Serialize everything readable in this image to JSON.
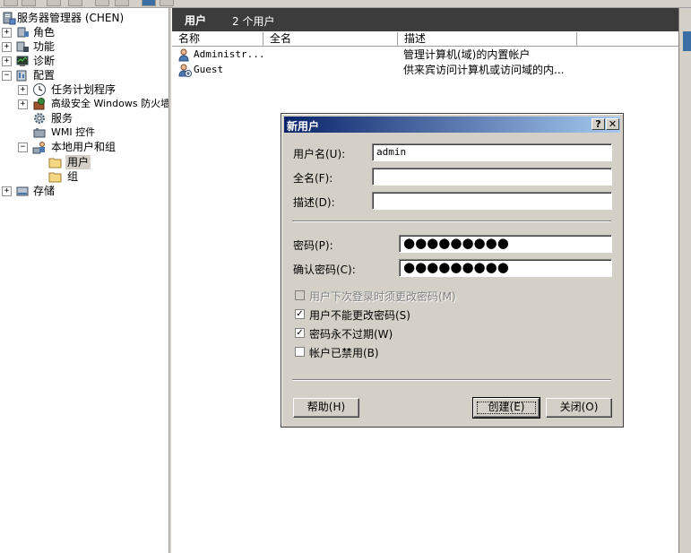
{
  "tree": {
    "root": "服务器管理器 (CHEN)",
    "roles": "角色",
    "features": "功能",
    "diagnostics": "诊断",
    "configuration": "配置",
    "task_scheduler": "任务计划程序",
    "firewall": "高级安全 Windows 防火墙",
    "services": "服务",
    "wmi": "WMI 控件",
    "local_users": "本地用户和组",
    "users": "用户",
    "groups": "组",
    "storage": "存储"
  },
  "list": {
    "title": "用户",
    "count": "2 个用户",
    "columns": [
      "名称",
      "全名",
      "描述"
    ],
    "rows": [
      {
        "name": "Administr...",
        "full_name": "",
        "description": "管理计算机(域)的内置帐户"
      },
      {
        "name": "Guest",
        "full_name": "",
        "description": "供来宾访问计算机或访问域的内..."
      }
    ]
  },
  "dialog": {
    "title": "新用户",
    "help_btn": "?",
    "close_btn": "✕",
    "username_label": "用户名(U):",
    "username_value": "admin",
    "fullname_label": "全名(F):",
    "fullname_value": "",
    "desc_label": "描述(D):",
    "desc_value": "",
    "password_label": "密码(P):",
    "password_value": "●●●●●●●●●",
    "confirm_label": "确认密码(C):",
    "confirm_value": "●●●●●●●●●",
    "checkboxes": [
      {
        "label": "用户下次登录时须更改密码(M)",
        "checked": false,
        "disabled": true
      },
      {
        "label": "用户不能更改密码(S)",
        "checked": true,
        "disabled": false
      },
      {
        "label": "密码永不过期(W)",
        "checked": true,
        "disabled": false
      },
      {
        "label": "帐户已禁用(B)",
        "checked": false,
        "disabled": false
      }
    ],
    "help_button": "帮助(H)",
    "create_button": "创建(E)",
    "close_button": "关闭(O)"
  },
  "colors": {
    "title_gradient_start": "#0a246a",
    "title_gradient_end": "#a6caf0",
    "dialog_bg": "#d4d0c8",
    "list_header_bg": "#3c3c3c"
  }
}
